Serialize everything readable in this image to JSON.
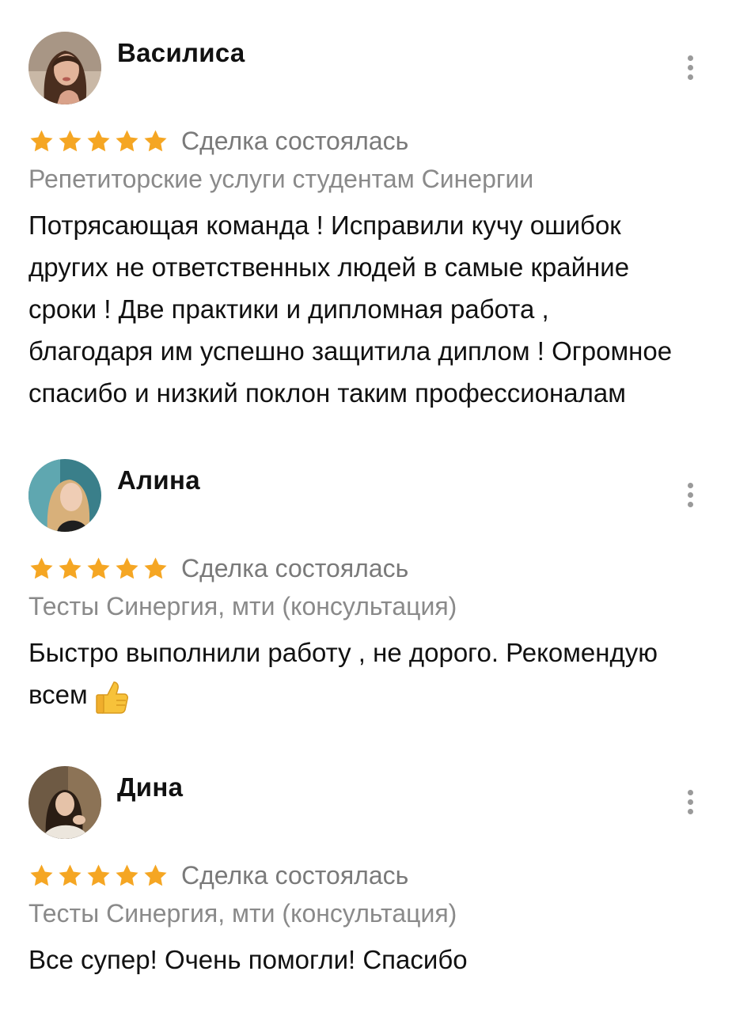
{
  "reviews": [
    {
      "author": "Василиса",
      "rating": 5,
      "status": "Сделка состоялась",
      "service": "Репетиторские услуги студентам Синергии",
      "text_lines": [
        "Потрясающая команда ! Исправили кучу ошибок",
        "других не ответственных людей в самые крайние",
        "сроки ! Две практики и дипломная работа ,",
        "благодаря им успешно защитила диплом ! Огромное",
        "спасибо и низкий поклон таким профессионалам"
      ]
    },
    {
      "author": "Алина",
      "rating": 5,
      "status": "Сделка состоялась",
      "service": "Тесты Синергия, мти (консультация)",
      "text_lines": [
        "Быстро выполнили работу , не дорого. Рекомендую",
        "всем"
      ],
      "emoji": "thumbs-up-icon"
    },
    {
      "author": "Дина",
      "rating": 5,
      "status": "Сделка состоялась",
      "service": "Тесты Синергия, мти (консультация)",
      "text_lines": [
        "Все супер! Очень помогли! Спасибо"
      ]
    }
  ],
  "colors": {
    "star": "#F5A623",
    "status_text": "#7A7A7A",
    "service_text": "#8A8A8A",
    "body_text": "#111111",
    "menu_dots": "#9A9A9A"
  }
}
